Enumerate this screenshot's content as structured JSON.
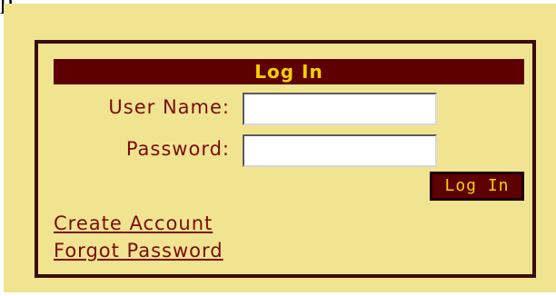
{
  "top_glyph": "p",
  "login": {
    "title": "Log In",
    "username_label": "User Name:",
    "username_value": "",
    "password_label": "Password:",
    "password_value": "",
    "submit_label": "Log In",
    "create_account_link": "Create Account",
    "forgot_password_link": "Forgot Password"
  },
  "colors": {
    "panel_background": "#f0e490",
    "frame_border": "#3a0c0c",
    "title_bar": "#5e0000",
    "title_text": "#f6d000",
    "label_text": "#7a0c0c"
  }
}
